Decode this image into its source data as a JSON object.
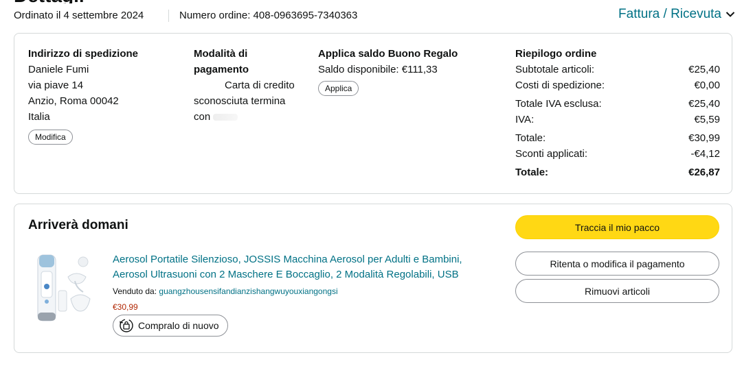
{
  "header": {
    "order_date": "Ordinato il 4 settembre 2024",
    "order_number": "Numero ordine: 408-0963695-7340363",
    "invoice_link": "Fattura / Ricevuta"
  },
  "shipping": {
    "title": "Indirizzo di spedizione",
    "lines": [
      "Daniele Fumi",
      "via piave 14",
      "Anzio, Roma 00042",
      "Italia"
    ],
    "edit_label": "Modifica"
  },
  "payment": {
    "title_line1": "Modalità di",
    "title_line2": "pagamento",
    "line1": "Carta di credito",
    "line2": "sconosciuta termina",
    "line3": "con"
  },
  "gift_card": {
    "title": "Applica saldo Buono Regalo",
    "balance": "Saldo disponibile: €111,33",
    "apply_label": "Applica"
  },
  "summary": {
    "title": "Riepilogo ordine",
    "rows": [
      {
        "label": "Subtotale articoli:",
        "value": "€25,40"
      },
      {
        "label": "Costi di spedizione:",
        "value": "€0,00"
      },
      {
        "label": "Totale IVA esclusa:",
        "value": "€25,40"
      },
      {
        "label": "IVA:",
        "value": "€5,59"
      },
      {
        "label": "Totale:",
        "value": "€30,99"
      },
      {
        "label": "Sconti applicati:",
        "value": "-€4,12"
      },
      {
        "label": "Totale:",
        "value": "€26,87"
      }
    ]
  },
  "delivery": {
    "title": "Arriverà domani",
    "product_title": "Aerosol Portatile Silenzioso, JOSSIS Macchina Aerosol per Adulti e Bambini, Aerosol Ultrasuoni con 2 Maschere E Boccaglio, 2 Modalità Regolabili, USB",
    "sold_by_label": "Venduto da:",
    "seller": "guangzhousensifandianzishangwuyouxiangongsi",
    "price": "€30,99",
    "buy_again_label": "Compralo di nuovo",
    "buy_again_icon": "reorder-bag-icon",
    "track_label": "Traccia il mio pacco",
    "retry_label": "Ritenta o modifica il pagamento",
    "remove_label": "Rimuovi articoli"
  },
  "colors": {
    "link": "#007185",
    "price": "#b12704",
    "track_button": "#ffd814",
    "border": "#d5d9d9"
  }
}
